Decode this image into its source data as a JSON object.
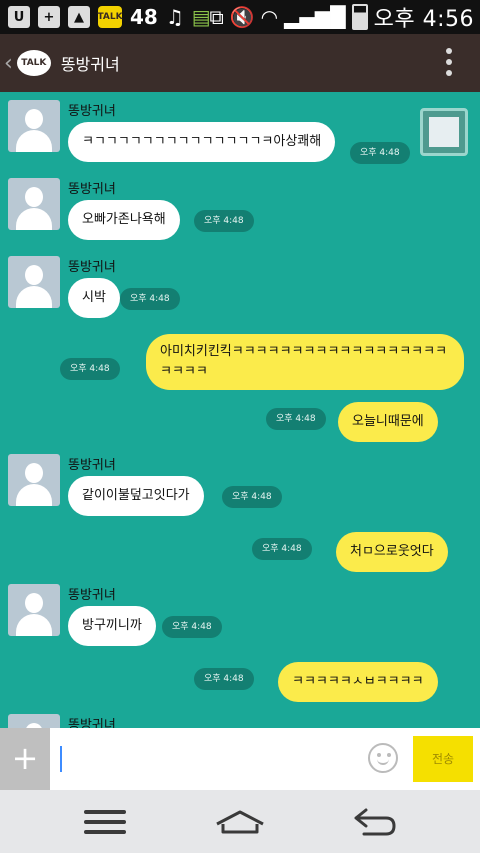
{
  "status_bar": {
    "badge_number": "48",
    "time": "오후 4:56",
    "talk_icon": "TALK"
  },
  "header": {
    "logo": "TALK",
    "title": "똥방귀녀"
  },
  "messages": [
    {
      "side": "in",
      "sender": "똥방귀녀",
      "text": "ㅋㄱㄱㄱㄱㄱㄱㄱㄱㄱㄱㄱㄱㄱㄱㅋ아상쾌해",
      "time": "오후 4:48"
    },
    {
      "side": "in",
      "sender": "똥방귀녀",
      "text": "오빠가존나욕해",
      "time": "오후 4:48"
    },
    {
      "side": "in",
      "sender": "똥방귀녀",
      "text": "시박",
      "time": "오후 4:48"
    },
    {
      "side": "out",
      "text": "아미치키킨킥ㅋㅋㅋㅋㅋㅋㅋㅋㅋㅋㅋㅋㅋㅋㅋㅋㅋㅋㅋㅋㅋㅋ",
      "time": "오후 4:48"
    },
    {
      "side": "out",
      "text": "오늘니때문에",
      "time": "오후 4:48"
    },
    {
      "side": "in",
      "sender": "똥방귀녀",
      "text": "같이이불덮고잇다가",
      "time": "오후 4:48"
    },
    {
      "side": "out",
      "text": "처ㅁ으로웃엇다",
      "time": "오후 4:48"
    },
    {
      "side": "in",
      "sender": "똥방귀녀",
      "text": "방구끼니까",
      "time": "오후 4:48"
    },
    {
      "side": "out",
      "text": "ㅋㅋㅋㅋㅋㅅㅂㅋㅋㅋㅋ",
      "time": "오후 4:48"
    },
    {
      "side": "in",
      "sender": "똥방귀녀",
      "text": "",
      "time": ""
    }
  ],
  "input": {
    "plus_label": "+",
    "send_label": "전송"
  },
  "icons": {
    "back": "chevron-left-icon",
    "menu": "more-vertical-icon",
    "emoji": "smiley-icon",
    "nav_menu": "menu-icon",
    "nav_home": "home-icon",
    "nav_back": "back-arrow-icon"
  }
}
